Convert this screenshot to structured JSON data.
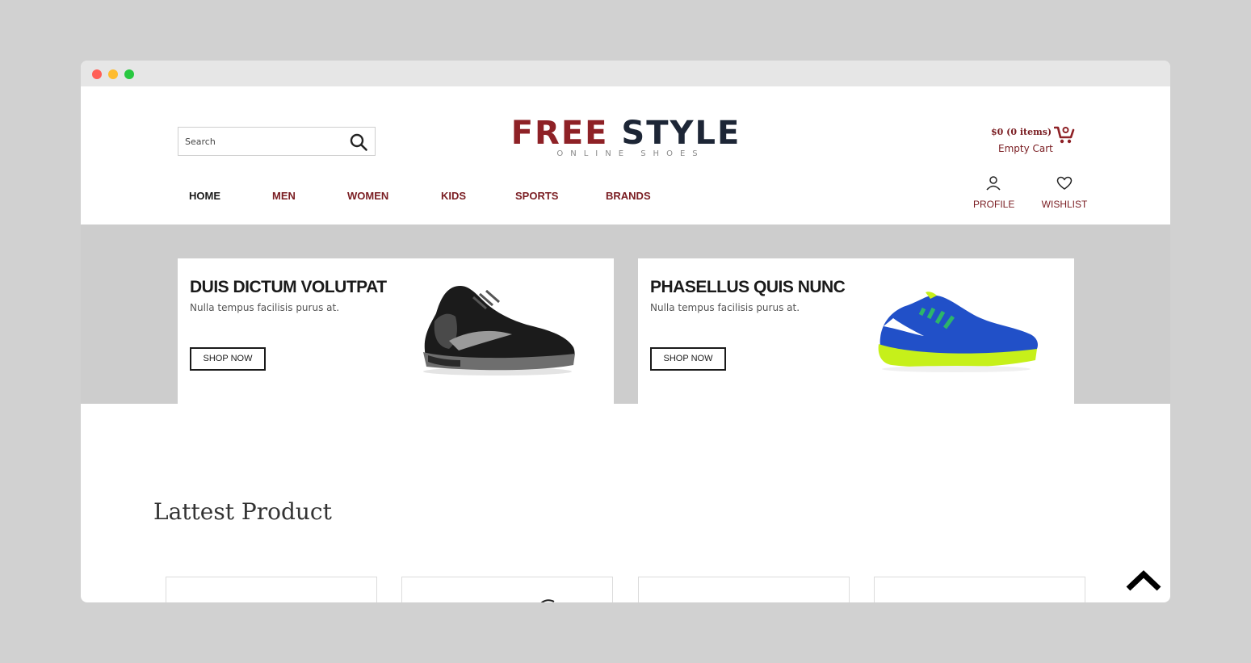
{
  "search": {
    "placeholder": "Search"
  },
  "logo": {
    "word1": "FREE",
    "word2": "STYLE",
    "tagline": "ONLINE SHOES"
  },
  "cart": {
    "total": "$0 (0 items)",
    "status": "Empty Cart"
  },
  "nav": [
    {
      "label": "HOME"
    },
    {
      "label": "MEN"
    },
    {
      "label": "WOMEN"
    },
    {
      "label": "KIDS"
    },
    {
      "label": "SPORTS"
    },
    {
      "label": "BRANDS"
    }
  ],
  "account": {
    "profile": "PROFILE",
    "wishlist": "WISHLIST"
  },
  "banners": [
    {
      "title": "DUIS DICTUM VOLUTPAT",
      "subtitle": "Nulla tempus facilisis purus at.",
      "button": "SHOP NOW"
    },
    {
      "title": "PHASELLUS QUIS NUNC",
      "subtitle": "Nulla tempus facilisis purus at.",
      "button": "SHOP NOW"
    }
  ],
  "latest": {
    "title": "Lattest Product"
  },
  "colors": {
    "brand": "#8e2126",
    "dark": "#1d2636",
    "band": "#cdcdcd"
  }
}
